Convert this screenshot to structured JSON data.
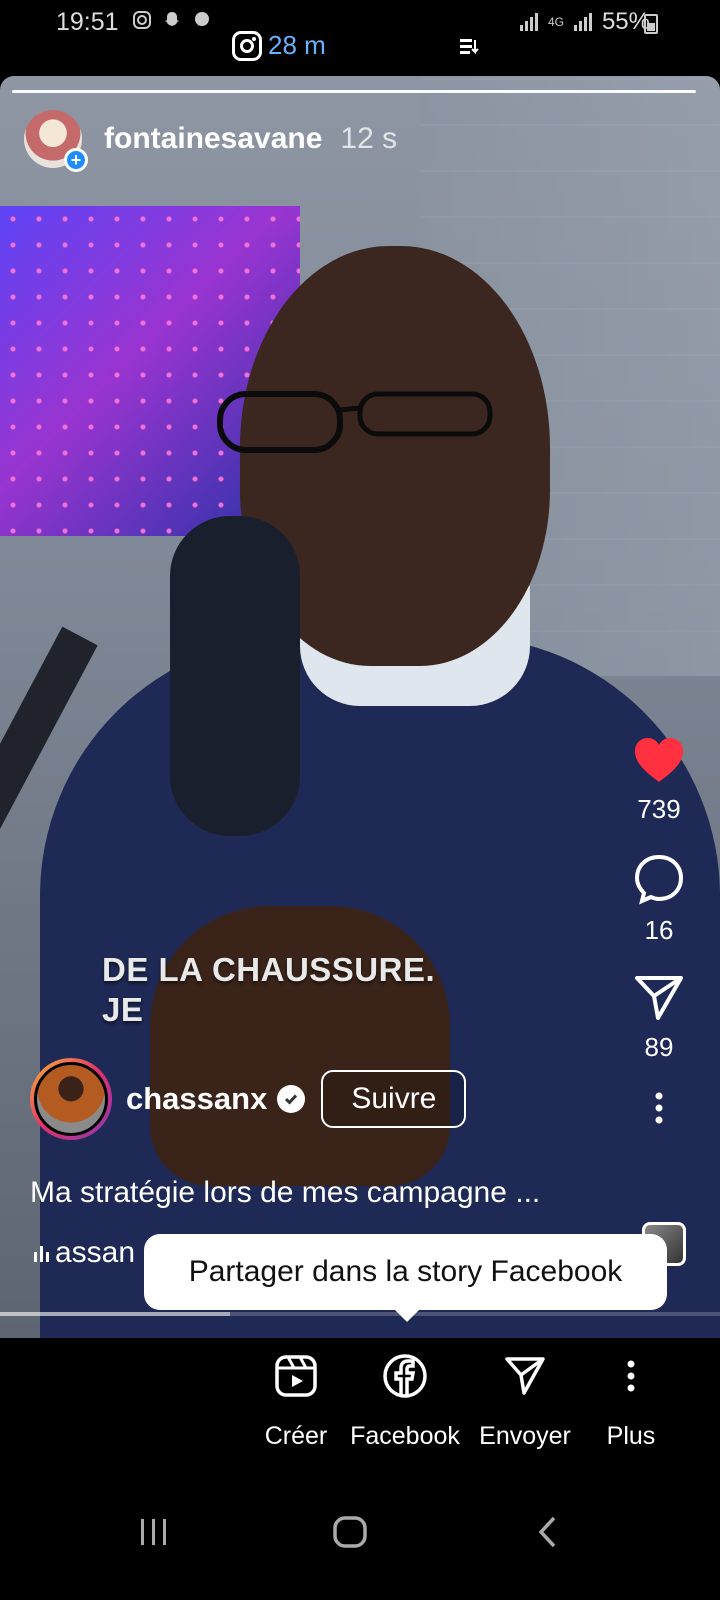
{
  "status_bar": {
    "time": "19:51",
    "network": "4G",
    "battery": "55%",
    "icons_left": [
      "instagram-icon",
      "snapchat-icon",
      "messenger-icon"
    ]
  },
  "app_header": {
    "app_icon": "instagram-icon",
    "elapsed": "28 m"
  },
  "story": {
    "username": "fontainesavane",
    "time_ago": "12 s"
  },
  "video_caption_overlay": {
    "line1": "DE LA CHAUSSURE.",
    "line2": "JE"
  },
  "actions": {
    "likes": "739",
    "comments": "16",
    "shares": "89",
    "like_color": "#ff3040"
  },
  "author": {
    "username": "chassanx",
    "verified": true,
    "follow_label": "Suivre"
  },
  "description": "Ma stratégie lors de mes campagne ...",
  "audio": {
    "label": "assan"
  },
  "tooltip": "Partager dans la story Facebook",
  "video_progress": 0.32,
  "share_sheet": {
    "items": [
      {
        "label": "Créer",
        "icon": "reels-create-icon"
      },
      {
        "label": "Facebook",
        "icon": "facebook-icon"
      },
      {
        "label": "Envoyer",
        "icon": "send-icon"
      },
      {
        "label": "Plus",
        "icon": "more-vertical-icon"
      }
    ]
  },
  "nav_bar": {
    "buttons": [
      "recent-apps-icon",
      "home-icon",
      "back-icon"
    ]
  },
  "colors": {
    "accent_blue": "#1d8cff",
    "link_blue": "#6ab0ff",
    "like_red": "#ff3040"
  }
}
